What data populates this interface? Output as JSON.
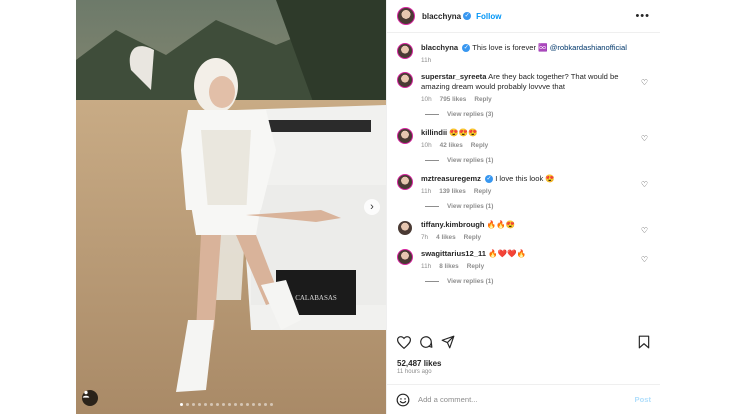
{
  "header": {
    "username": "blacchyna",
    "follow_label": "Follow",
    "more_icon": "more-horizontal-icon"
  },
  "caption": {
    "username": "blacchyna",
    "text": "This love is forever ♾️",
    "mention": "@robkardashianofficial",
    "time": "11h"
  },
  "comments": [
    {
      "username": "superstar_syreeta",
      "text": "Are they back together? That would be amazing dream would probably lovvve that",
      "time": "10h",
      "likes": "795 likes",
      "reply": "Reply",
      "view_replies": "View replies (3)"
    },
    {
      "username": "killindii",
      "text": "😍😍😍",
      "time": "10h",
      "likes": "42 likes",
      "reply": "Reply",
      "view_replies": "View replies (1)"
    },
    {
      "username": "mztreasuregemz",
      "text": "I love this look 😍",
      "time": "11h",
      "likes": "139 likes",
      "reply": "Reply",
      "view_replies": "View replies (1)"
    },
    {
      "username": "tiffany.kimbrough",
      "text": "🔥🔥😍",
      "time": "7h",
      "likes": "4 likes",
      "reply": "Reply"
    },
    {
      "username": "swagittarius12_11",
      "text": "🔥❤️❤️🔥",
      "time": "11h",
      "likes": "8 likes",
      "reply": "Reply",
      "view_replies": "View replies (1)"
    }
  ],
  "post_meta": {
    "likes": "52,487 likes",
    "time": "11 hours ago"
  },
  "add_comment": {
    "placeholder": "Add a comment...",
    "post_label": "Post"
  },
  "colors": {
    "accent": "#0095f6",
    "post_disabled": "#b2dffc",
    "ring": "#d6249f"
  }
}
